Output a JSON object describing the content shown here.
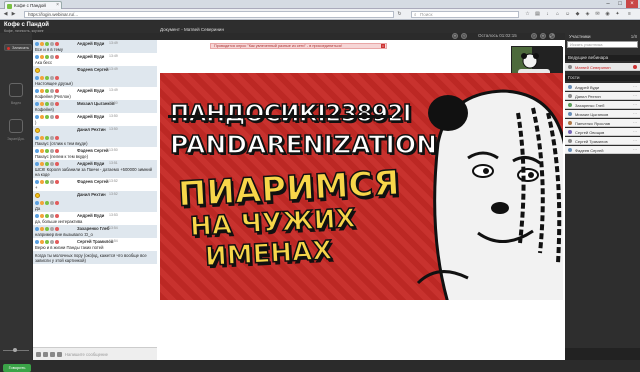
{
  "browser": {
    "tab_title": "Кофе с Пандой",
    "url": "https://login.webinar.ru/...",
    "search_placeholder": "Поиск"
  },
  "app": {
    "title": "Кофе с Пандой",
    "subtitle": "Кофе, личность, коучинг",
    "document_label": "Документ - Матвей Северинин",
    "language": "Русский",
    "timer": "Осталось 01:02:15"
  },
  "left_sidebar": {
    "record_label": "Записать",
    "items": [
      {
        "label": "Видео"
      },
      {
        "label": "Экран/Док."
      }
    ],
    "speak_label": "Говорить"
  },
  "chat": {
    "messages": [
      {
        "author": "Андрей Вуди",
        "time": "13:49",
        "text": "Все и я в тему",
        "alt": true
      },
      {
        "author": "Андрей Вуди",
        "time": "13:49",
        "text": "Ака бесс",
        "alt": false
      },
      {
        "author": "Фадеев Сергей",
        "time": "13:49",
        "text": "Настоящее друзья)",
        "emoji": true,
        "alt": true
      },
      {
        "author": "Андрей Вуди",
        "time": "13:49",
        "text": "Кофейня (Реплон)",
        "alt": false
      },
      {
        "author": "Михаил Цыганков",
        "time": "13:50",
        "text": "Кофейня)",
        "alt": true
      },
      {
        "author": "Андрей Вуди",
        "time": "13:50",
        "text": ")",
        "alt": false
      },
      {
        "author": "Данил Рехтин",
        "time": "13:50",
        "text": "Пакаус (отлиж к тем вкуде)",
        "emoji": true,
        "alt": true
      },
      {
        "author": "Фадеев Сергей",
        "time": "13:50",
        "text": "Пакаус (пелем к тем вкуде)",
        "alt": false
      },
      {
        "author": "Андрей Вуди",
        "time": "13:51",
        "text": "ШСК! Короля забанили за Панчи - датаемо +500000 зимний на коде",
        "alt": true
      },
      {
        "author": "Фадеев Сергей",
        "time": "13:52",
        "text": "+",
        "alt": false
      },
      {
        "author": "Данил Рехтин",
        "time": "13:52",
        "text": "Да",
        "emoji": true,
        "alt": true
      },
      {
        "author": "Андрей Вуди",
        "time": "13:53",
        "text": "да, больше интерактива",
        "alt": false
      },
      {
        "author": "Захаренко Глеб",
        "time": "13:54",
        "text": "например вне вызывало :D_о",
        "alt": true
      },
      {
        "author": "Сергей Трамилов",
        "time": "13:54",
        "text": "Верю и в жизни Панды таких потей",
        "alt": false
      },
      {
        "author": "",
        "time": "",
        "text": "Когда ты молочных пору (око)кд, кажется что вообще все зависли у этой картинкой)",
        "alt": true
      }
    ],
    "input_placeholder": "Напишите сообщение"
  },
  "banner": {
    "text": "Проводится опрос \"Как увлеченный разные из сети\" - в присоединиться!"
  },
  "slide": {
    "title_struck": "ПАНДОСИКI23892I",
    "title": "PANDARENIZATION",
    "line1": "ПИАРИМСЯ",
    "line2": "НА ЧУЖИХ",
    "line3": "ИМЕНАХ"
  },
  "right_panel": {
    "participants_label": "Участники",
    "participants_count": "1/8",
    "search_placeholder": "Искать участника",
    "host_section_label": "Ведущие вебинара",
    "host": "Матвей Северинин",
    "guests_section_label": "Гости",
    "guests": [
      "Андрей Вуди",
      "Данил Рехтин",
      "Захаренко Глеб",
      "Михаил Цыганков",
      "Панченко Ярослав",
      "Сергей Овощов",
      "Сергей Трамилов",
      "Фадеев Сергей"
    ]
  }
}
